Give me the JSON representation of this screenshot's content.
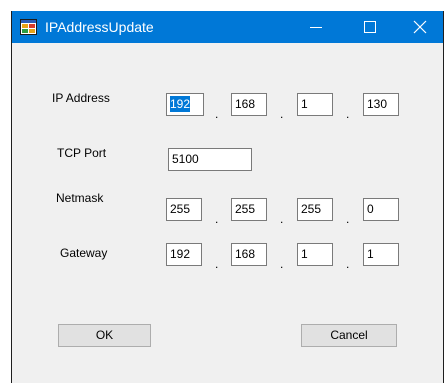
{
  "window": {
    "title": "IPAddressUpdate",
    "icon": "form-icon",
    "controls": {
      "minimize_glyph": "—",
      "maximize_glyph": "☐",
      "close_glyph": "✕"
    }
  },
  "form": {
    "ip_address": {
      "label": "IP Address",
      "octets": [
        "192",
        "168",
        "1",
        "130"
      ]
    },
    "tcp_port": {
      "label": "TCP Port",
      "value": "5100"
    },
    "netmask": {
      "label": "Netmask",
      "octets": [
        "255",
        "255",
        "255",
        "0"
      ]
    },
    "gateway": {
      "label": "Gateway",
      "octets": [
        "192",
        "168",
        "1",
        "1"
      ]
    },
    "separator": "."
  },
  "buttons": {
    "ok": "OK",
    "cancel": "Cancel"
  },
  "colors": {
    "titlebar": "#0078d7",
    "selection": "#0078d7",
    "window_bg": "#f0f0f0"
  }
}
